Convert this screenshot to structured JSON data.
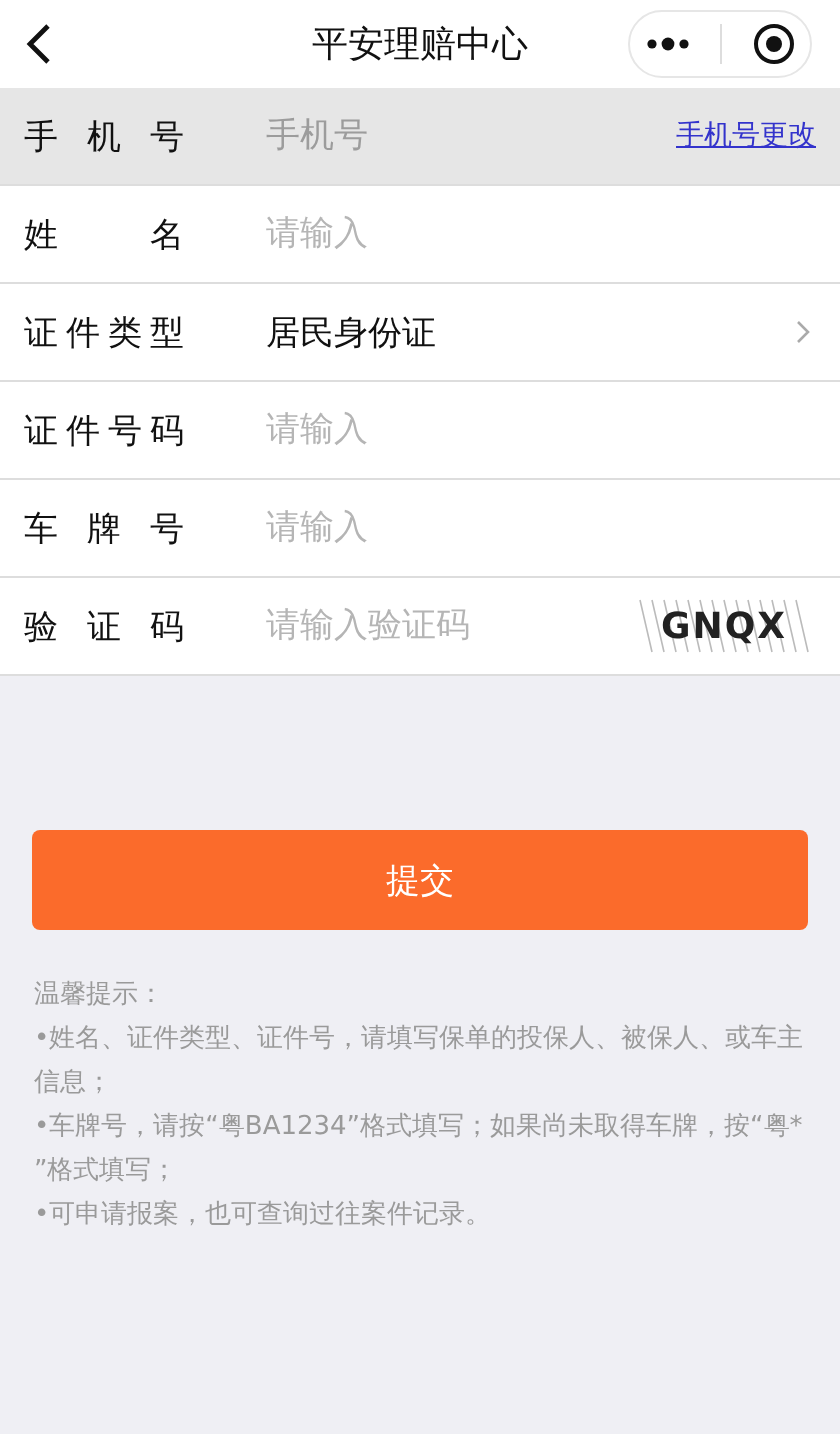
{
  "nav": {
    "title": "平安理赔中心"
  },
  "rows": [
    {
      "kind": "field",
      "label": "手机号",
      "placeholder": "手机号",
      "disabled": true,
      "link": "手机号更改"
    },
    {
      "kind": "field",
      "label": "姓名",
      "placeholder": "请输入",
      "disabled": false
    },
    {
      "kind": "select",
      "label": "证件类型",
      "value": "居民身份证",
      "disabled": false
    },
    {
      "kind": "field",
      "label": "证件号码",
      "placeholder": "请输入",
      "disabled": false
    },
    {
      "kind": "field",
      "label": "车牌号",
      "placeholder": "请输入",
      "disabled": false
    },
    {
      "kind": "captcha",
      "label": "验证码",
      "placeholder": "请输入验证码",
      "disabled": false,
      "code": "GNQX"
    }
  ],
  "submit": "提交",
  "tips": [
    "温馨提示：",
    "•姓名、证件类型、证件号，请填写保单的投保人、被保人、或车主信息；",
    "•车牌号，请按“粤BA1234”格式填写；如果尚未取得车牌，按“粤* ”格式填写；",
    "•可申请报案，也可查询过往案件记录。"
  ]
}
